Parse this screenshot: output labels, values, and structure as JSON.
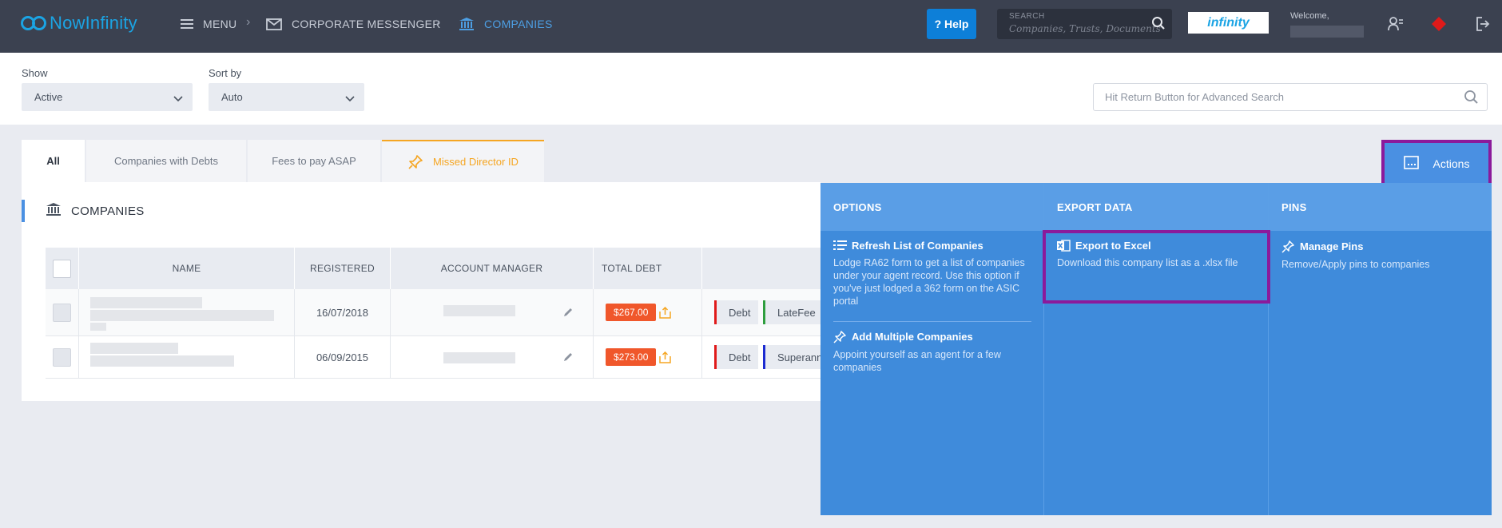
{
  "topbar": {
    "logo_text": "NowInfinity",
    "menu_label": "MENU",
    "breadcrumb_1": "CORPORATE MESSENGER",
    "breadcrumb_2": "COMPANIES",
    "help_label": "? Help",
    "search_label": "SEARCH",
    "search_placeholder": "Companies, Trusts, Documents",
    "brand_label": "infinity",
    "welcome": "Welcome,"
  },
  "filters": {
    "show_label": "Show",
    "show_value": "Active",
    "sort_label": "Sort by",
    "sort_value": "Auto",
    "advanced_search_placeholder": "Hit Return Button for Advanced Search"
  },
  "tabs": [
    {
      "label": "All"
    },
    {
      "label": "Companies with Debts"
    },
    {
      "label": "Fees to pay ASAP"
    },
    {
      "label": "Missed Director ID"
    }
  ],
  "actions_label": "Actions",
  "panel": {
    "title": "COMPANIES",
    "columns": [
      "NAME",
      "REGISTERED",
      "ACCOUNT MANAGER",
      "TOTAL DEBT"
    ],
    "rows": [
      {
        "registered": "16/07/2018",
        "total_debt": "$267.00",
        "tags": [
          "Debt",
          "LateFee"
        ]
      },
      {
        "registered": "06/09/2015",
        "total_debt": "$273.00",
        "tags": [
          "Debt",
          "Superann"
        ]
      }
    ]
  },
  "mega_menu": {
    "options": {
      "heading": "OPTIONS",
      "items": [
        {
          "title": "Refresh List of Companies",
          "desc": "Lodge RA62 form to get a list of companies under your agent record. Use this option if you've just lodged a 362 form on the ASIC portal"
        },
        {
          "title": "Add Multiple Companies",
          "desc": "Appoint yourself as an agent for a few companies"
        }
      ]
    },
    "export": {
      "heading": "EXPORT DATA",
      "items": [
        {
          "title": "Export to Excel",
          "desc": "Download this company list as a .xlsx file"
        }
      ]
    },
    "pins": {
      "heading": "PINS",
      "items": [
        {
          "title": "Manage Pins",
          "desc": "Remove/Apply pins to companies"
        }
      ]
    }
  },
  "colors": {
    "topbar": "#3b4150",
    "accent": "#4a90e2",
    "debt": "#f0572b",
    "highlight": "#8b1a9b",
    "missed_tab": "#f5a623"
  }
}
